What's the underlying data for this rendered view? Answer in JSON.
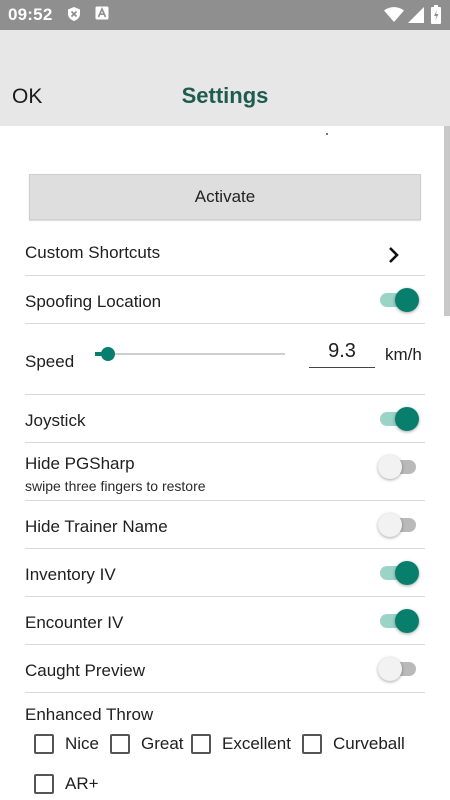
{
  "status_bar": {
    "time": "09:52",
    "icons": [
      "notification-x-icon",
      "text-a-icon",
      "wifi-icon",
      "signal-icon",
      "battery-icon"
    ]
  },
  "header": {
    "ok_label": "OK",
    "title": "Settings",
    "title_color": "#1e5c4f"
  },
  "activate_label": "Activate",
  "rows": {
    "custom_shortcuts": {
      "label": "Custom Shortcuts"
    },
    "spoofing_location": {
      "label": "Spoofing Location",
      "enabled": true
    },
    "speed": {
      "label": "Speed",
      "value": "9.3",
      "unit": "km/h",
      "slider_fraction": 0.07
    },
    "joystick": {
      "label": "Joystick",
      "enabled": true
    },
    "hide_pgsharp": {
      "label": "Hide PGSharp",
      "sublabel": "swipe three fingers to restore",
      "enabled": false
    },
    "hide_trainer_name": {
      "label": "Hide Trainer Name",
      "enabled": false
    },
    "inventory_iv": {
      "label": "Inventory IV",
      "enabled": true
    },
    "encounter_iv": {
      "label": "Encounter IV",
      "enabled": true
    },
    "caught_preview": {
      "label": "Caught Preview",
      "enabled": false
    }
  },
  "enhanced_throw": {
    "label": "Enhanced Throw",
    "options": [
      {
        "label": "Nice",
        "checked": false
      },
      {
        "label": "Great",
        "checked": false
      },
      {
        "label": "Excellent",
        "checked": false
      },
      {
        "label": "Curveball",
        "checked": false
      },
      {
        "label": "AR+",
        "checked": false
      }
    ]
  },
  "colors": {
    "accent": "#087f6c",
    "accent_track": "#9bd3c6",
    "header_bg": "#e7e7e7",
    "status_bar_bg": "#8f8f8f"
  }
}
